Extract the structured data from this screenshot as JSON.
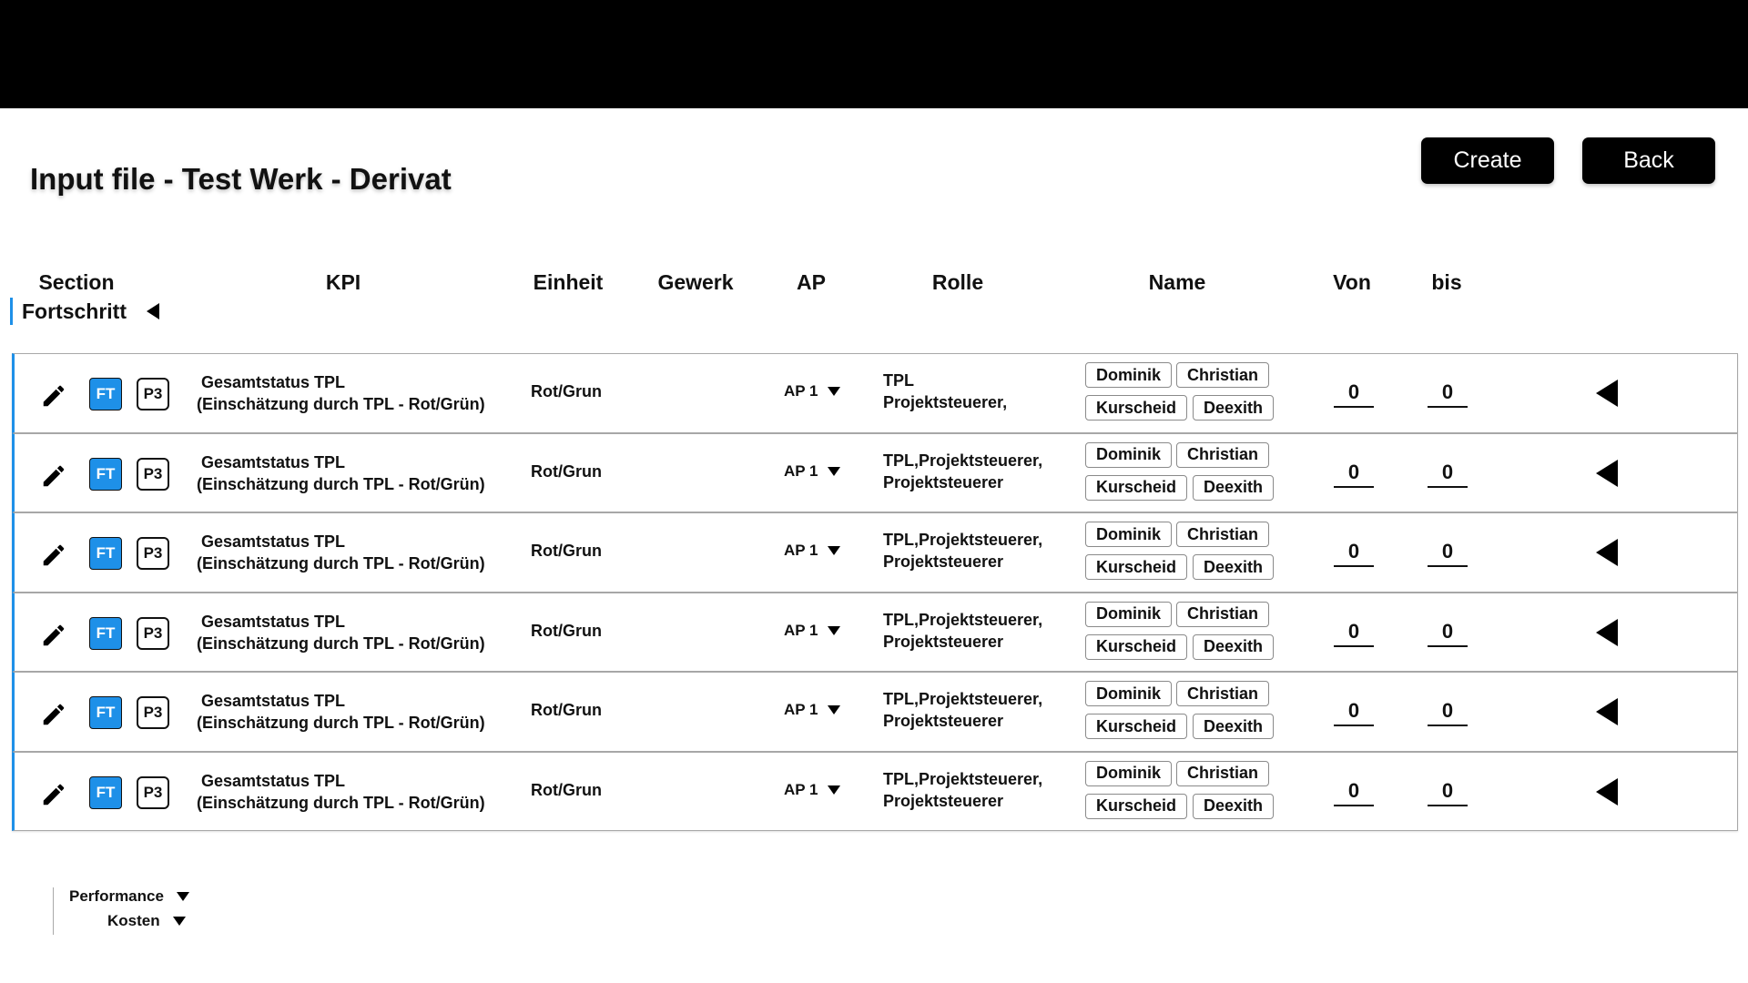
{
  "page": {
    "title": "Input file - Test Werk - Derivat",
    "create_label": "Create",
    "back_label": "Back"
  },
  "columns": {
    "section": "Section",
    "kpi": "KPI",
    "einheit": "Einheit",
    "gewerk": "Gewerk",
    "ap": "AP",
    "rolle": "Rolle",
    "name": "Name",
    "von": "Von",
    "bis": "bis"
  },
  "active_section": {
    "label": "Fortschritt",
    "accent_color": "#1e90e8"
  },
  "rows": [
    {
      "badge_ft": "FT",
      "badge_p3": "P3",
      "kpi_line1": "Gesamtstatus TPL",
      "kpi_line2": "(Einschätzung durch TPL - Rot/Grün)",
      "einheit": "Rot/Grun",
      "ap": "AP 1",
      "rolle_line1": "TPL",
      "rolle_line2": "Projektsteuerer,",
      "names": [
        "Dominik",
        "Christian",
        "Kurscheid",
        "Deexith"
      ],
      "von": "0",
      "bis": "0"
    },
    {
      "badge_ft": "FT",
      "badge_p3": "P3",
      "kpi_line1": "Gesamtstatus TPL",
      "kpi_line2": "(Einschätzung durch TPL - Rot/Grün)",
      "einheit": "Rot/Grun",
      "ap": "AP 1",
      "rolle_line1": "TPL,Projektsteuerer,",
      "rolle_line2": "Projektsteuerer",
      "names": [
        "Dominik",
        "Christian",
        "Kurscheid",
        "Deexith"
      ],
      "von": "0",
      "bis": "0"
    },
    {
      "badge_ft": "FT",
      "badge_p3": "P3",
      "kpi_line1": "Gesamtstatus TPL",
      "kpi_line2": "(Einschätzung durch TPL - Rot/Grün)",
      "einheit": "Rot/Grun",
      "ap": "AP 1",
      "rolle_line1": "TPL,Projektsteuerer,",
      "rolle_line2": "Projektsteuerer",
      "names": [
        "Dominik",
        "Christian",
        "Kurscheid",
        "Deexith"
      ],
      "von": "0",
      "bis": "0"
    },
    {
      "badge_ft": "FT",
      "badge_p3": "P3",
      "kpi_line1": "Gesamtstatus TPL",
      "kpi_line2": "(Einschätzung durch TPL - Rot/Grün)",
      "einheit": "Rot/Grun",
      "ap": "AP 1",
      "rolle_line1": "TPL,Projektsteuerer,",
      "rolle_line2": "Projektsteuerer",
      "names": [
        "Dominik",
        "Christian",
        "Kurscheid",
        "Deexith"
      ],
      "von": "0",
      "bis": "0"
    },
    {
      "badge_ft": "FT",
      "badge_p3": "P3",
      "kpi_line1": "Gesamtstatus TPL",
      "kpi_line2": "(Einschätzung durch TPL - Rot/Grün)",
      "einheit": "Rot/Grun",
      "ap": "AP 1",
      "rolle_line1": "TPL,Projektsteuerer,",
      "rolle_line2": "Projektsteuerer",
      "names": [
        "Dominik",
        "Christian",
        "Kurscheid",
        "Deexith"
      ],
      "von": "0",
      "bis": "0"
    },
    {
      "badge_ft": "FT",
      "badge_p3": "P3",
      "kpi_line1": "Gesamtstatus TPL",
      "kpi_line2": "(Einschätzung durch TPL - Rot/Grün)",
      "einheit": "Rot/Grun",
      "ap": "AP 1",
      "rolle_line1": "TPL,Projektsteuerer,",
      "rolle_line2": "Projektsteuerer",
      "names": [
        "Dominik",
        "Christian",
        "Kurscheid",
        "Deexith"
      ],
      "von": "0",
      "bis": "0"
    }
  ],
  "icons": {
    "edit": "pencil-icon",
    "row_action": "triangle-left-icon",
    "expand": "triangle-down-icon"
  },
  "sections_collapsed": [
    {
      "label": "Performance"
    },
    {
      "label": "Kosten"
    }
  ]
}
